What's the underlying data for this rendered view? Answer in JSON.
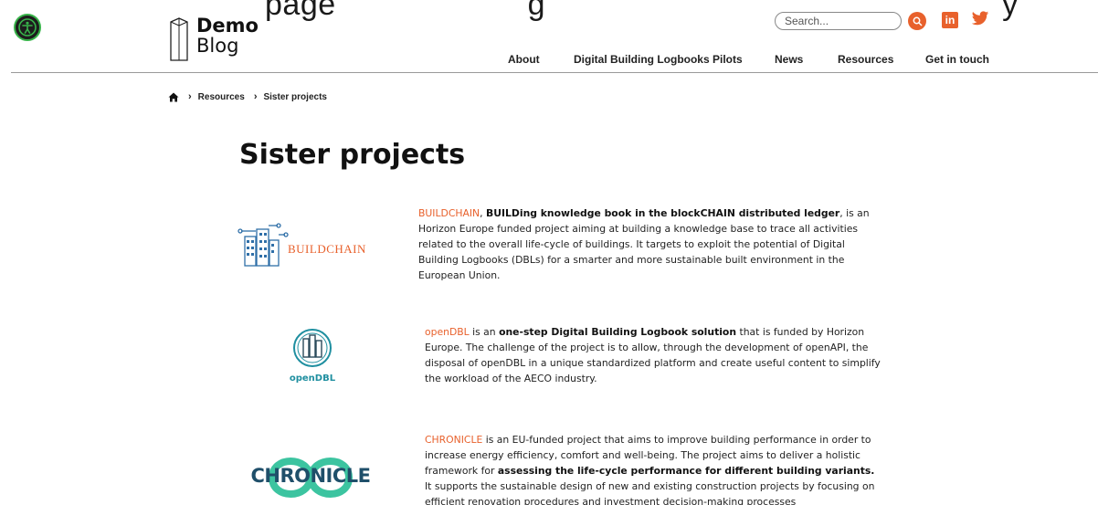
{
  "header": {
    "ghost_text": "page  ... ... g  ...  ... ... ... ... ... ... ...  ... ...y",
    "logo": {
      "line1": "Demo",
      "line2": "Blog"
    },
    "search": {
      "placeholder": "Search..."
    },
    "social": {
      "linkedin_label": "in"
    }
  },
  "nav": [
    {
      "label": "About"
    },
    {
      "label": "Digital Building Logbooks Pilots"
    },
    {
      "label": "News"
    },
    {
      "label": "Resources"
    },
    {
      "label": "Get in touch"
    }
  ],
  "breadcrumb": [
    {
      "label": "Resources"
    },
    {
      "label": "Sister projects"
    }
  ],
  "page_title": "Sister projects",
  "projects": [
    {
      "logo_text": "BUILDCHAIN",
      "link": "BUILDCHAIN",
      "sep": ", ",
      "bold": "BUILDing knowledge book in the blockCHAIN distributed ledger",
      "rest": ", is an Horizon Europe funded project aiming at building a knowledge base to trace all activities related to the overall life-cycle of buildings. It targets to exploit the potential of Digital Building Logbooks (DBLs) for a smarter and more sustainable built environment in the European Union."
    },
    {
      "logo_text": "openDBL",
      "link": "openDBL",
      "pre": " is an ",
      "bold": "one-step Digital Building Logbook solution",
      "rest": " that is funded by Horizon Europe. The challenge of the project is to allow, through the development of openAPI, the disposal of openDBL in a unique standardized platform and create useful content to simplify the workload of the AECO industry."
    },
    {
      "logo_text": "CHRONICLE",
      "link": "CHRONICLE",
      "pre": " is an EU-funded project that aims to improve building performance in order to increase energy efficiency, comfort and well-being. The project aims to deliver a holistic framework for ",
      "bold": "assessing the life-cycle performance for different building variants.",
      "rest": " It supports the sustainable design of new and existing construction projects by focusing on efficient renovation procedures and investment decision-making processes"
    }
  ],
  "colors": {
    "accent": "#e8612c",
    "a11y_ring": "#38b34a",
    "buildchain_blue": "#2f6fa8",
    "opendbl_teal": "#1f8fa0",
    "chronicle_green": "#3cc4a0"
  }
}
